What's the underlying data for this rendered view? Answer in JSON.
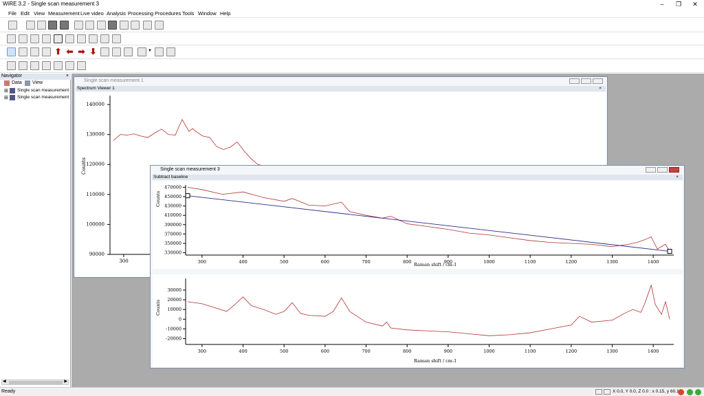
{
  "app": {
    "title": "WiRE 3.2 - Single scan measurement 3"
  },
  "menu": [
    "File",
    "Edit",
    "View",
    "Measurement",
    "Live video",
    "Analysis",
    "Processing",
    "Procedures",
    "Tools",
    "Window",
    "Help"
  ],
  "navigator": {
    "title": "Navigator",
    "tabs": [
      "Data",
      "View"
    ],
    "items": [
      "Single scan measurement 1",
      "Single scan measurement 3"
    ]
  },
  "window1": {
    "title": "Single scan measurement 1",
    "subtitle": "Spectrum Viewer 1"
  },
  "window3": {
    "title": "Single scan measurement 3",
    "subtitle": "Subtract baseline"
  },
  "status": {
    "left": "Ready",
    "coords": "X 0.0, Y 0.0, Z 0.0 : x 0.15, y 60.16"
  },
  "chart_data": [
    {
      "type": "line",
      "ylabel": "Counts",
      "yticks": [
        90000,
        100000,
        110000,
        120000,
        130000,
        140000
      ],
      "xticks": [
        300
      ],
      "series": [
        {
          "x": [
            180,
            200,
            220,
            240,
            260,
            280,
            300,
            320,
            340,
            360,
            370,
            380,
            390,
            400,
            410,
            420,
            440,
            460,
            480,
            500,
            520,
            540,
            560,
            580,
            600,
            620,
            640
          ],
          "values": [
            128000,
            130000,
            129800,
            130200,
            129500,
            129000,
            130500,
            131800,
            130000,
            129800,
            132500,
            135000,
            133000,
            131000,
            132000,
            131000,
            129500,
            129000,
            126000,
            125000,
            125800,
            127500,
            124500,
            122000,
            120000,
            119500,
            118500
          ]
        }
      ]
    },
    {
      "type": "line",
      "xlabel": "Raman shift / cm-1",
      "ylabel": "Counts",
      "xlim": [
        260,
        1450
      ],
      "ylim": [
        325000,
        475000
      ],
      "yticks": [
        330000,
        350000,
        370000,
        390000,
        410000,
        430000,
        450000,
        470000
      ],
      "xticks": [
        300,
        400,
        500,
        600,
        700,
        800,
        900,
        1000,
        1100,
        1200,
        1300,
        1400
      ],
      "series": [
        {
          "x": [
            265,
            300,
            350,
            400,
            450,
            500,
            520,
            560,
            600,
            640,
            660,
            700,
            740,
            760,
            800,
            850,
            900,
            950,
            1000,
            1050,
            1100,
            1150,
            1200,
            1250,
            1300,
            1340,
            1360,
            1380,
            1395,
            1410,
            1430,
            1440
          ],
          "values": [
            470000,
            465000,
            455000,
            460000,
            448000,
            440000,
            446000,
            432000,
            430000,
            438000,
            418000,
            410000,
            404000,
            408000,
            392000,
            386000,
            380000,
            372000,
            368000,
            362000,
            356000,
            352000,
            350000,
            348000,
            343000,
            348000,
            352000,
            358000,
            364000,
            338000,
            348000,
            332000
          ]
        },
        {
          "x": [
            265,
            1440
          ],
          "values": [
            452000,
            333000
          ]
        }
      ]
    },
    {
      "type": "line",
      "xlabel": "Raman shift / cm-1",
      "ylabel": "Counts",
      "xlim": [
        260,
        1450
      ],
      "ylim": [
        -26000,
        42000
      ],
      "yticks": [
        -20000,
        -10000,
        0,
        10000,
        20000,
        30000
      ],
      "xticks": [
        300,
        400,
        500,
        600,
        700,
        800,
        900,
        1000,
        1100,
        1200,
        1300,
        1400
      ],
      "series": [
        {
          "x": [
            265,
            300,
            330,
            360,
            380,
            400,
            420,
            450,
            480,
            500,
            520,
            540,
            560,
            600,
            620,
            640,
            660,
            700,
            740,
            750,
            760,
            800,
            850,
            900,
            950,
            1000,
            1050,
            1100,
            1150,
            1200,
            1220,
            1250,
            1300,
            1330,
            1350,
            1370,
            1380,
            1395,
            1405,
            1420,
            1430,
            1440
          ],
          "values": [
            18000,
            16000,
            12000,
            8000,
            15000,
            23000,
            14000,
            10000,
            5000,
            8000,
            17000,
            6000,
            4000,
            3000,
            8000,
            22000,
            8000,
            -3000,
            -7000,
            -3000,
            -9000,
            -11000,
            -12000,
            -13000,
            -15000,
            -17000,
            -16000,
            -14000,
            -10000,
            -6000,
            3000,
            -3000,
            -1000,
            6000,
            10000,
            7000,
            17000,
            35000,
            15000,
            5000,
            18000,
            0
          ]
        }
      ]
    }
  ]
}
